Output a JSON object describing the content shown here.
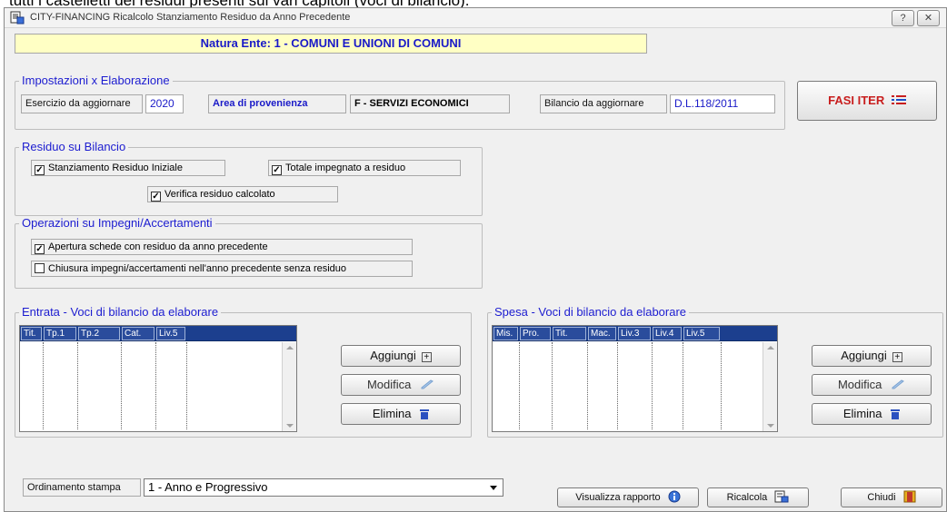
{
  "document_text": "tutti i castelletti dei residui presenti sui vari capitoli (voci di bilancio).",
  "window": {
    "title": "CITY-FINANCING  Ricalcolo Stanziamento Residuo da Anno Precedente",
    "help_label": "?",
    "close_label": "✕"
  },
  "natura_ente": "Natura Ente:   1 - COMUNI E UNIONI DI COMUNI",
  "impostazioni": {
    "title": "Impostazioni x Elaborazione",
    "esercizio_label": "Esercizio da aggiornare",
    "esercizio_value": "2020",
    "area_label": "Area di provenienza",
    "area_value": "F - SERVIZI ECONOMICI",
    "bilancio_label": "Bilancio da aggiornare",
    "bilancio_value": "D.L.118/2011"
  },
  "fasi_iter_label": "FASI ITER",
  "residuo": {
    "title": "Residuo su Bilancio",
    "items": [
      {
        "label": "Stanziamento Residuo Iniziale",
        "checked": "✓"
      },
      {
        "label": "Totale impegnato a residuo",
        "checked": "✓"
      },
      {
        "label": "Verifica residuo calcolato",
        "checked": "✓"
      }
    ]
  },
  "operazioni": {
    "title": "Operazioni su Impegni/Accertamenti",
    "items": [
      {
        "label": "Apertura schede con residuo da anno precedente",
        "checked": "✓"
      },
      {
        "label": "Chiusura impegni/accertamenti nell'anno precedente senza residuo",
        "checked": ""
      }
    ]
  },
  "entrata": {
    "title": "Entrata - Voci di bilancio da elaborare",
    "columns": [
      "Tit.",
      "Tp.1",
      "Tp.2",
      "Cat.",
      "Liv.5"
    ],
    "rows": []
  },
  "spesa": {
    "title": "Spesa - Voci di bilancio da elaborare",
    "columns": [
      "Mis.",
      "Pro.",
      "Tit.",
      "Mac.",
      "Liv.3",
      "Liv.4",
      "Liv.5"
    ],
    "rows": []
  },
  "buttons": {
    "aggiungi": "Aggiungi",
    "modifica": "Modifica",
    "elimina": "Elimina",
    "visualizza": "Visualizza rapporto",
    "ricalcola": "Ricalcola",
    "chiudi": "Chiudi"
  },
  "ordinamento": {
    "label": "Ordinamento stampa",
    "selected": "1 - Anno e Progressivo"
  },
  "colors": {
    "accent_blue": "#1a1ac8",
    "grid_header": "#1c3f8e",
    "fasi_red": "#c81e1e",
    "natura_bg": "#ffffc4"
  }
}
